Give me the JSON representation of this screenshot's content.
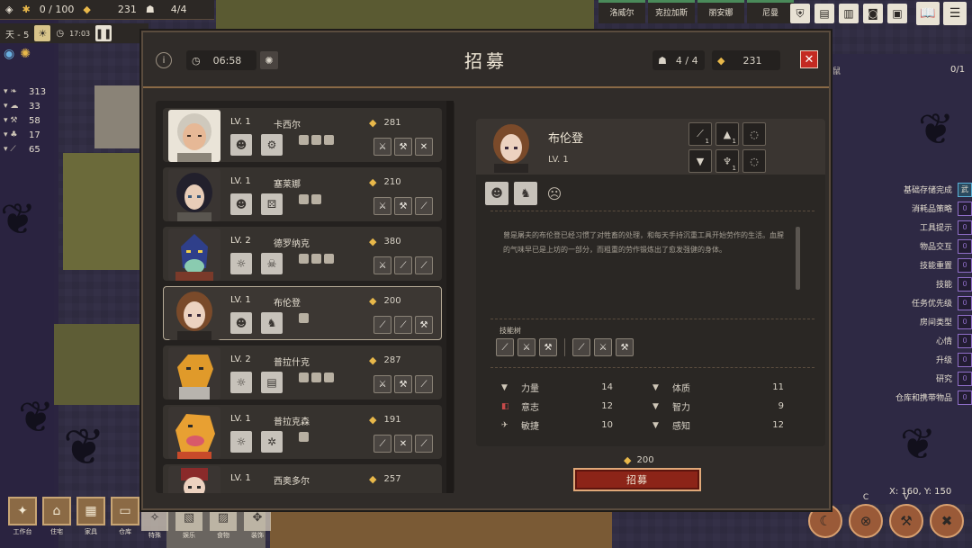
{
  "hud": {
    "storage": "0 / 100",
    "gold": "231",
    "population": "4/4",
    "day": "天 - 5",
    "clock": "17:03",
    "resources": [
      {
        "icon": "resource-1",
        "value": "313"
      },
      {
        "icon": "resource-2",
        "value": "33"
      },
      {
        "icon": "resource-3",
        "value": "58"
      },
      {
        "icon": "resource-4",
        "value": "17"
      },
      {
        "icon": "resource-5",
        "value": "65"
      }
    ]
  },
  "colonists_top": [
    "洛威尔",
    "克拉加斯",
    "丽安娜",
    "尼曼"
  ],
  "zoom": {
    "label": "鼠",
    "value": "0/1"
  },
  "coords": "X: 160, Y: 150",
  "side_toggles": [
    {
      "label": "基础存储完成",
      "state": "on",
      "mark": "武"
    },
    {
      "label": "消耗品策略",
      "state": "off",
      "mark": "0"
    },
    {
      "label": "工具提示",
      "state": "off",
      "mark": "0"
    },
    {
      "label": "物品交互",
      "state": "off",
      "mark": "0"
    },
    {
      "label": "技能重置",
      "state": "off",
      "mark": "0"
    },
    {
      "label": "技能",
      "state": "off",
      "mark": "0"
    },
    {
      "label": "任务优先级",
      "state": "off",
      "mark": "0"
    },
    {
      "label": "房间类型",
      "state": "off",
      "mark": "0"
    },
    {
      "label": "心情",
      "state": "off",
      "mark": "0"
    },
    {
      "label": "升级",
      "state": "off",
      "mark": "0"
    },
    {
      "label": "研究",
      "state": "off",
      "mark": "0"
    },
    {
      "label": "仓库和携带物品",
      "state": "off",
      "mark": "0"
    }
  ],
  "bottom_menu": [
    "工作台",
    "住宅",
    "家具",
    "仓库"
  ],
  "bottom_menu_2": [
    "特殊",
    "娱乐",
    "食物",
    "装饰"
  ],
  "bottom_actions": [
    {
      "key": "X"
    },
    {
      "key": "C"
    },
    {
      "key": "V"
    },
    {
      "key": ""
    }
  ],
  "dialog": {
    "title": "招募",
    "timer": "06:58",
    "population": "4 / 4",
    "gold": "231"
  },
  "recruits": [
    {
      "level": "LV. 1",
      "name": "卡西尔",
      "cost": "281",
      "face": "elder",
      "selected": false
    },
    {
      "level": "LV. 1",
      "name": "塞莱娜",
      "cost": "210",
      "face": "dark",
      "selected": false
    },
    {
      "level": "LV. 2",
      "name": "德罗纳克",
      "cost": "380",
      "face": "dragonblue",
      "selected": false
    },
    {
      "level": "LV. 1",
      "name": "布伦登",
      "cost": "200",
      "face": "brown",
      "selected": true
    },
    {
      "level": "LV. 2",
      "name": "普拉什克",
      "cost": "287",
      "face": "lizardorange",
      "selected": false
    },
    {
      "level": "LV. 1",
      "name": "普拉克森",
      "cost": "191",
      "face": "lizardorange2",
      "selected": false
    },
    {
      "level": "LV. 1",
      "name": "西奥多尔",
      "cost": "257",
      "face": "red",
      "selected": false
    }
  ],
  "detail": {
    "name": "布伦登",
    "level": "LV. 1",
    "bio": "曾是屠夫的布伦登已经习惯了对牲畜的处理，和每天手持沉重工具开始劳作的生活。血腥的气味早已是上坊的一部分，而粗重的劳作锻炼出了愈发强健的身体。",
    "skill_tree_label": "技能树",
    "stats": [
      {
        "left_label": "力量",
        "left_value": "14",
        "right_label": "体质",
        "right_value": "11"
      },
      {
        "left_label": "意志",
        "left_value": "12",
        "right_label": "智力",
        "right_value": "9"
      },
      {
        "left_label": "敏捷",
        "left_value": "10",
        "right_label": "感知",
        "right_value": "12"
      }
    ],
    "cost": "200",
    "recruit_label": "招募"
  }
}
